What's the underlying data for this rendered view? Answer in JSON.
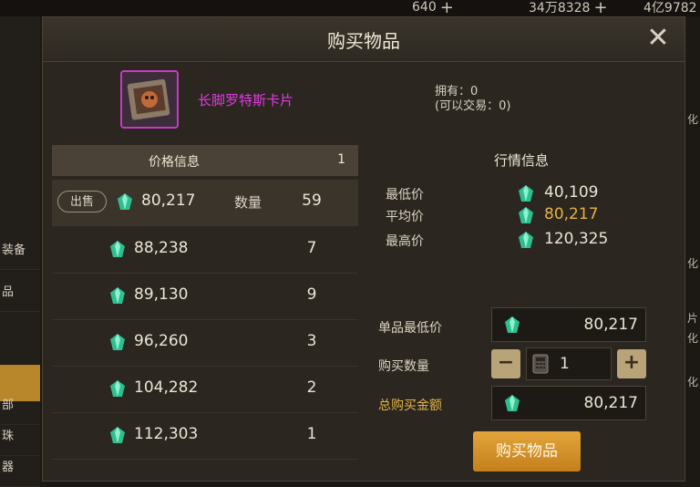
{
  "background": {
    "resources": [
      "640",
      "34万8328",
      "4亿9782"
    ],
    "left_menu": [
      "装备",
      "品",
      "部",
      "珠",
      "器"
    ],
    "right_edge": [
      "化",
      "化",
      "片",
      "化",
      "化"
    ]
  },
  "dialog": {
    "title": "购买物品",
    "item": {
      "name": "长脚罗特斯卡片",
      "owned_line1": "拥有：0",
      "owned_line2": "(可以交易：0)"
    },
    "price_panel": {
      "header": "价格信息",
      "page": "1",
      "sell_label": "出售",
      "qty_label": "数量",
      "rows": [
        {
          "price": "80,217",
          "qty": "59"
        },
        {
          "price": "88,238",
          "qty": "7"
        },
        {
          "price": "89,130",
          "qty": "9"
        },
        {
          "price": "96,260",
          "qty": "3"
        },
        {
          "price": "104,282",
          "qty": "2"
        },
        {
          "price": "112,303",
          "qty": "1"
        }
      ]
    },
    "market_panel": {
      "header": "行情信息",
      "lowest_label": "最低价",
      "lowest": "40,109",
      "average_label": "平均价",
      "average": "80,217",
      "highest_label": "最高价",
      "highest": "120,325"
    },
    "purchase": {
      "unit_price_label": "单品最低价",
      "unit_price": "80,217",
      "quantity_label": "购买数量",
      "quantity": "1",
      "total_label": "总购买金额",
      "total": "80,217",
      "buy_button": "购买物品"
    }
  },
  "colors": {
    "gem": "#2fbf8f",
    "accent_gold": "#e6b246",
    "item_name": "#e23be0"
  },
  "icons": {
    "close": "close-icon",
    "gem": "gem-icon",
    "minus": "minus-icon",
    "plus": "plus-icon",
    "calculator": "calculator-icon"
  }
}
